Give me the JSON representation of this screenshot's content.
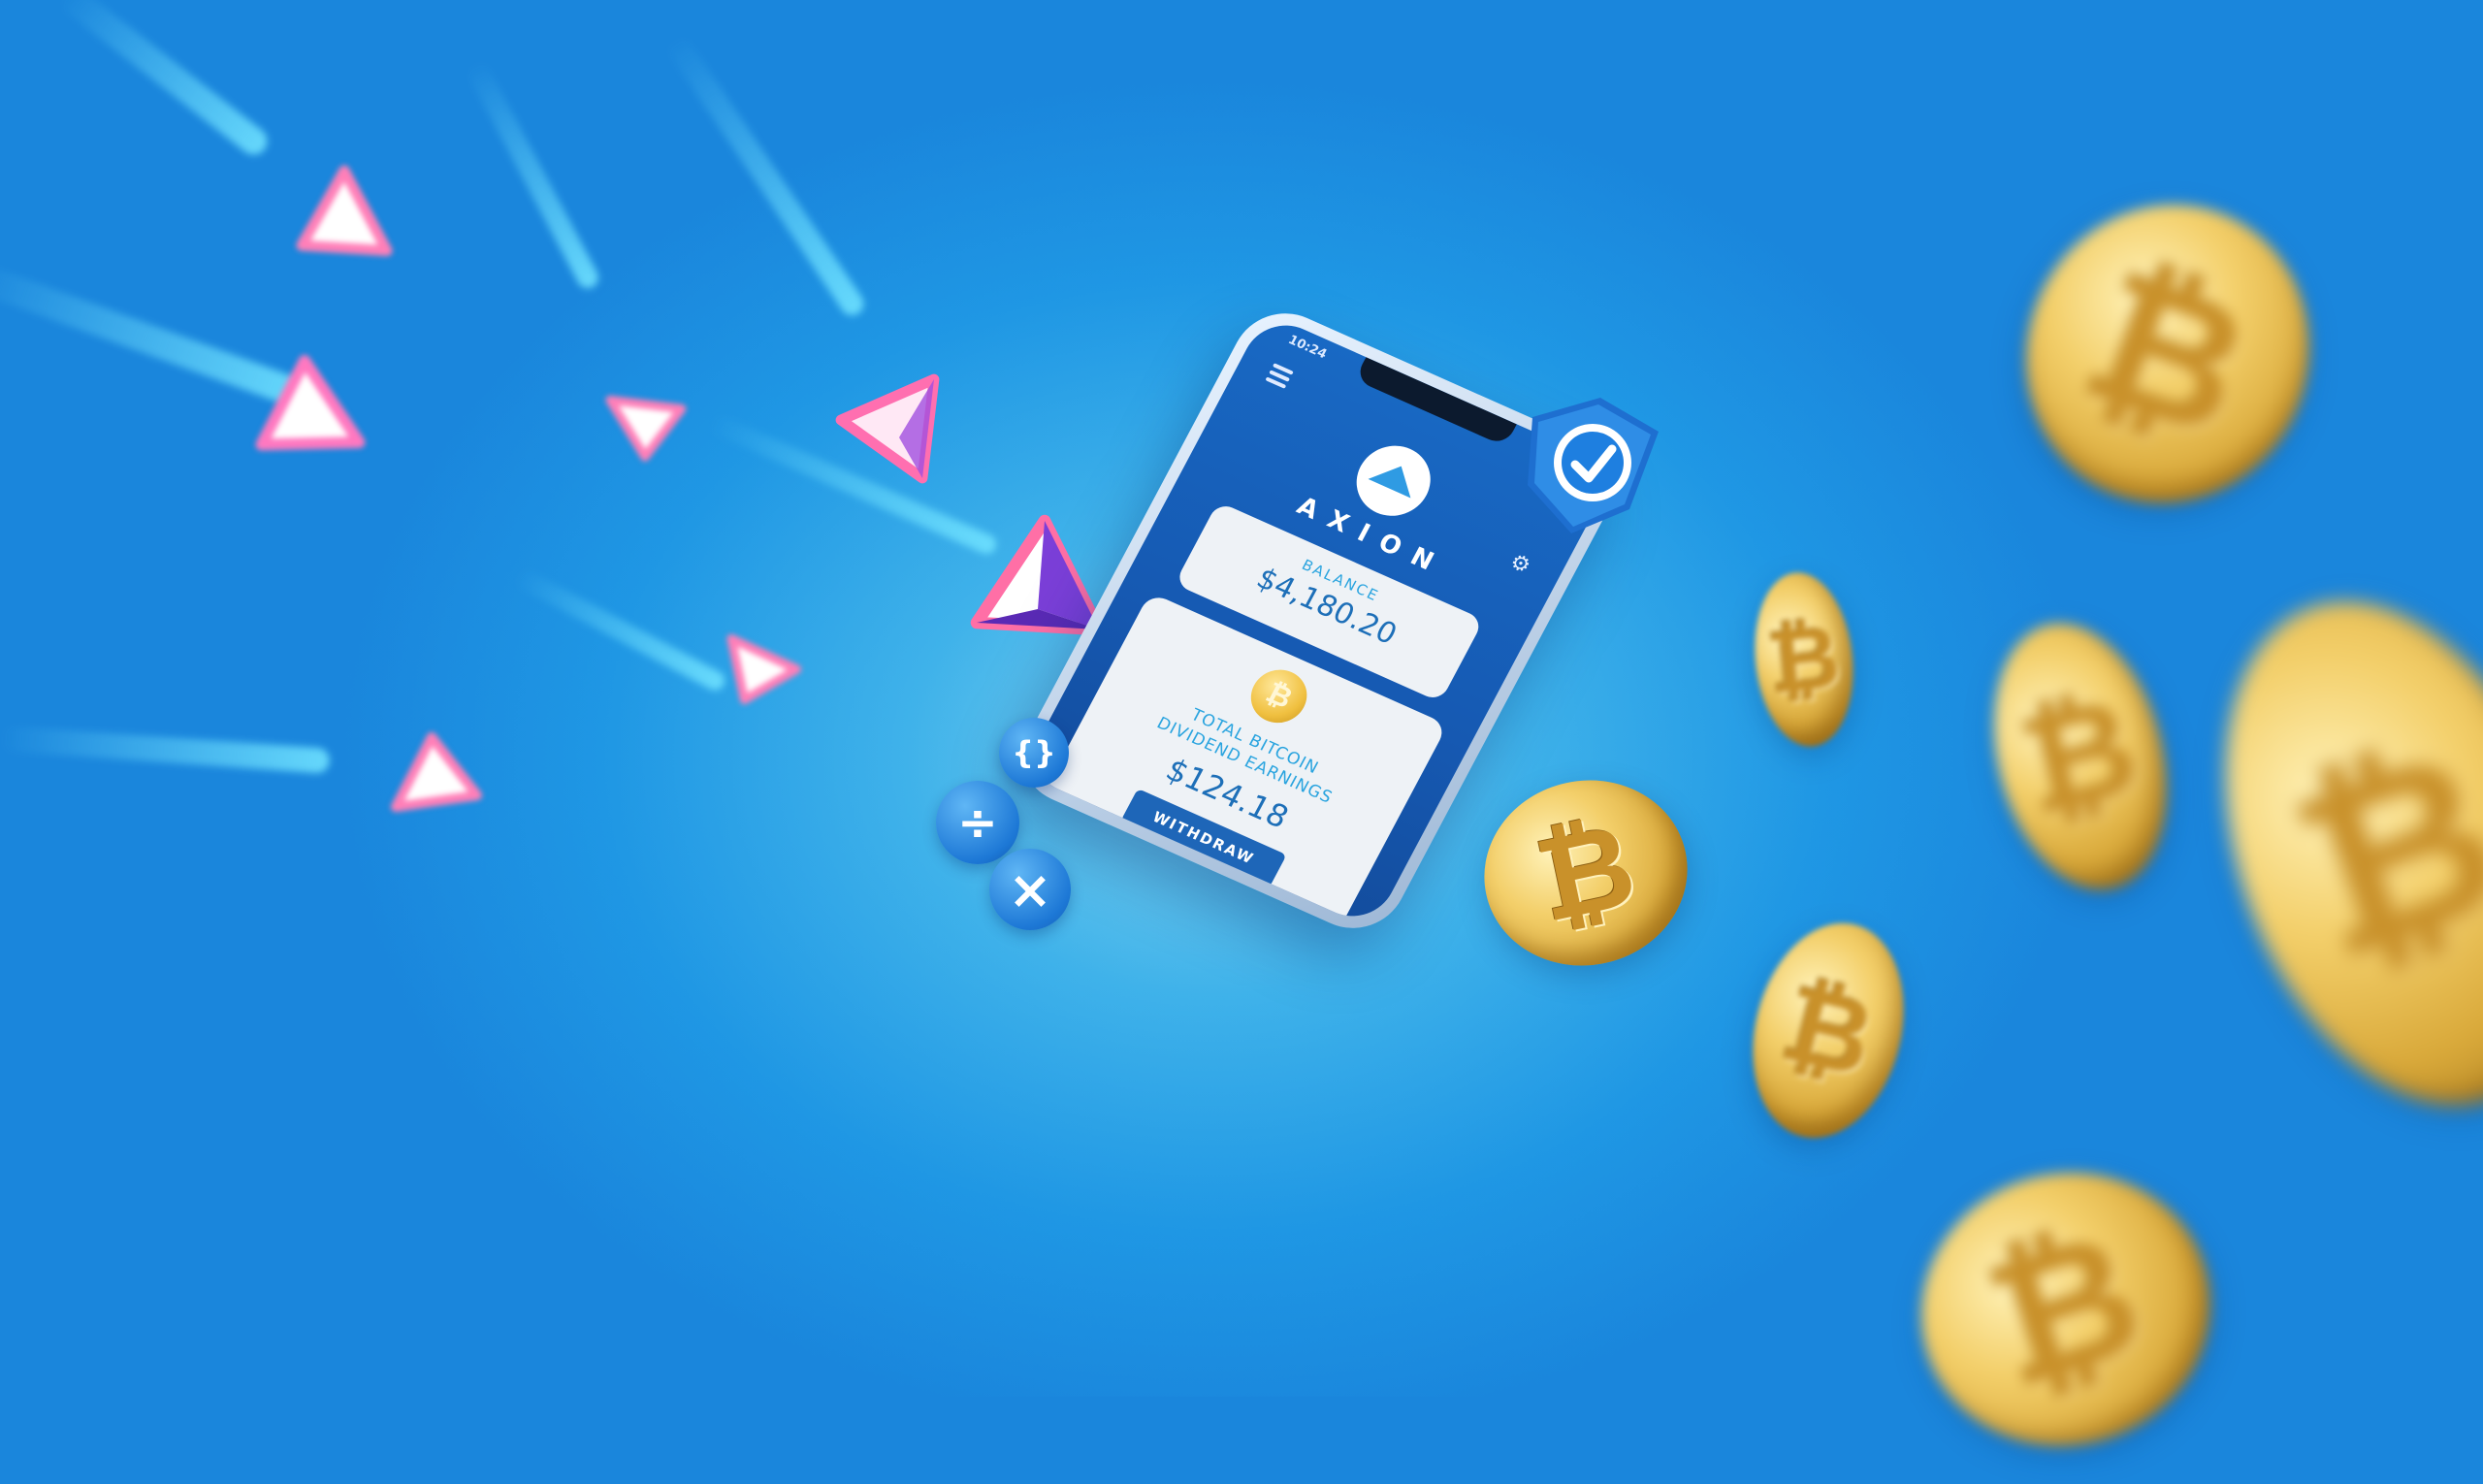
{
  "phone": {
    "status_time": "10:24",
    "status_icons": "▴ ◆ ▮",
    "brand": "AXION",
    "balance": {
      "label": "BALANCE",
      "value": "$4,180.20"
    },
    "earnings": {
      "label": "TOTAL BITCOIN DIVIDEND EARNINGS",
      "value": "$124.18"
    },
    "withdraw_label": "WITHDRAW",
    "btc_symbol": "₿"
  },
  "symbols": {
    "braces": "{}",
    "divide": "÷",
    "times": "×"
  },
  "coin_symbol": "₿",
  "colors": {
    "background": "#1f97e4",
    "phone_screen": "#1869c4",
    "accent_text": "#2aa4df",
    "value_text": "#1d6fb8",
    "coin_gold": "#e8bd52",
    "triangle_pink": "#ff6fb0",
    "triangle_purple": "#7b3fd8"
  }
}
